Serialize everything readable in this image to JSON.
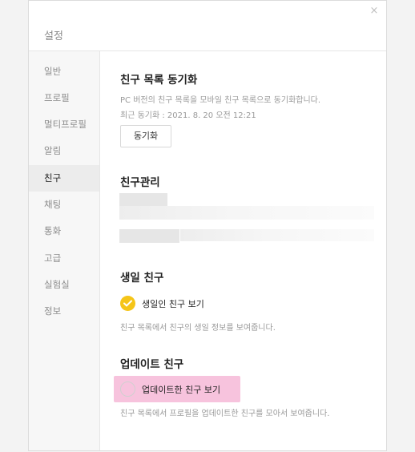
{
  "window": {
    "title": "설정",
    "close_glyph": "×"
  },
  "sidebar": {
    "items": [
      {
        "label": "일반"
      },
      {
        "label": "프로필"
      },
      {
        "label": "멀티프로필"
      },
      {
        "label": "알림"
      },
      {
        "label": "친구",
        "active": true
      },
      {
        "label": "채팅"
      },
      {
        "label": "통화"
      },
      {
        "label": "고급"
      },
      {
        "label": "실험실"
      },
      {
        "label": "정보"
      }
    ]
  },
  "sync": {
    "title": "친구 목록 동기화",
    "description": "PC 버전의 친구 목록을 모바일 친구 목록으로 동기화합니다.",
    "last_sync": "최근 동기화 : 2021. 8. 20 오전 12:21",
    "button_label": "동기화"
  },
  "manage": {
    "title": "친구관리"
  },
  "birthday": {
    "title": "생일 친구",
    "option_label": "생일인 친구 보기",
    "option_checked": true,
    "description": "친구 목록에서 친구의 생일 정보를 보여줍니다."
  },
  "update": {
    "title": "업데이트 친구",
    "option_label": "업데이트한 친구 보기",
    "option_checked": false,
    "description": "친구 목록에서 프로필을 업데이트한 친구를 모아서 보여줍니다."
  },
  "colors": {
    "accent": "#f5c518",
    "highlight": "#f7c3dd"
  }
}
